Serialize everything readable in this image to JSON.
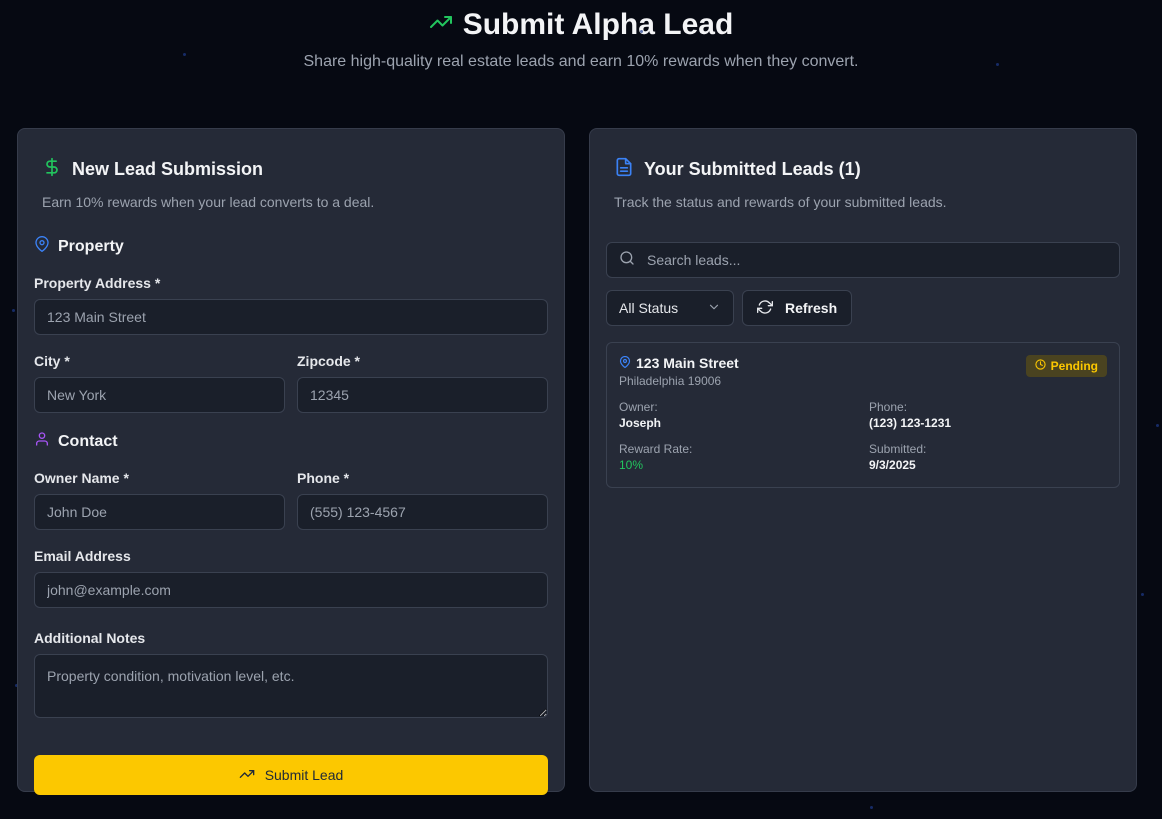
{
  "header": {
    "title": "Submit Alpha Lead",
    "subtitle": "Share high-quality real estate leads and earn 10% rewards when they convert."
  },
  "form_card": {
    "title": "New Lead Submission",
    "description": "Earn 10% rewards when your lead converts to a deal.",
    "property_section": "Property",
    "property_address_label": "Property Address *",
    "property_address_placeholder": "123 Main Street",
    "city_label": "City *",
    "city_placeholder": "New York",
    "zipcode_label": "Zipcode *",
    "zipcode_placeholder": "12345",
    "contact_section": "Contact",
    "owner_name_label": "Owner Name *",
    "owner_name_placeholder": "John Doe",
    "phone_label": "Phone *",
    "phone_placeholder": "(555) 123-4567",
    "email_label": "Email Address",
    "email_placeholder": "john@example.com",
    "notes_label": "Additional Notes",
    "notes_placeholder": "Property condition, motivation level, etc.",
    "submit_label": "Submit Lead"
  },
  "leads_card": {
    "title": "Your Submitted Leads (1)",
    "description": "Track the status and rewards of your submitted leads.",
    "search_placeholder": "Search leads...",
    "status_filter": "All Status",
    "refresh_label": "Refresh",
    "leads": [
      {
        "address": "123 Main Street",
        "city_zip": "Philadelphia 19006",
        "status": "Pending",
        "owner_label": "Owner:",
        "owner": "Joseph",
        "phone_label": "Phone:",
        "phone": "(123) 123-1231",
        "reward_label": "Reward Rate:",
        "reward": "10%",
        "submitted_label": "Submitted:",
        "submitted": "9/3/2025"
      }
    ]
  },
  "colors": {
    "background": "#060912",
    "card": "#252a37",
    "accent_yellow": "#fcc800",
    "accent_green": "#22c55e",
    "accent_blue": "#3b82f6",
    "accent_purple": "#a855f7"
  }
}
